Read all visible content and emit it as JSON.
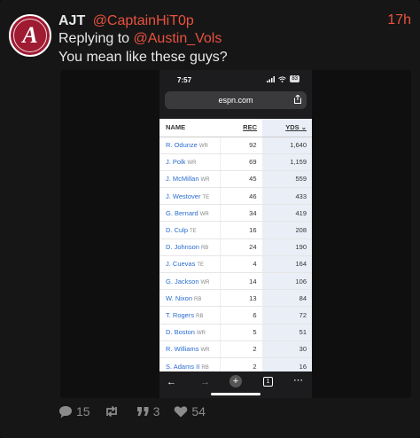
{
  "post": {
    "author_name": "AJT",
    "author_handle": "@CaptainHiT0p",
    "timestamp": "17h",
    "replying_prefix": "Replying to",
    "replying_to": "@Austin_Vols",
    "text": "You mean like these guys?",
    "avatar_logo_text": "ALABAMA CRIMSON TIDE",
    "avatar_letter": "A"
  },
  "screenshot": {
    "status_time": "7:57",
    "battery": "83",
    "url": "espn.com",
    "headers": {
      "name": "NAME",
      "rec": "REC",
      "yds": "YDS"
    },
    "rows": [
      {
        "name": "R. Odunze",
        "pos": "WR",
        "rec": "92",
        "yds": "1,640"
      },
      {
        "name": "J. Polk",
        "pos": "WR",
        "rec": "69",
        "yds": "1,159"
      },
      {
        "name": "J. McMillan",
        "pos": "WR",
        "rec": "45",
        "yds": "559"
      },
      {
        "name": "J. Westover",
        "pos": "TE",
        "rec": "46",
        "yds": "433"
      },
      {
        "name": "G. Bernard",
        "pos": "WR",
        "rec": "34",
        "yds": "419"
      },
      {
        "name": "D. Culp",
        "pos": "TE",
        "rec": "16",
        "yds": "208"
      },
      {
        "name": "D. Johnson",
        "pos": "RB",
        "rec": "24",
        "yds": "190"
      },
      {
        "name": "J. Cuevas",
        "pos": "TE",
        "rec": "4",
        "yds": "164"
      },
      {
        "name": "G. Jackson",
        "pos": "WR",
        "rec": "14",
        "yds": "106"
      },
      {
        "name": "W. Nixon",
        "pos": "RB",
        "rec": "13",
        "yds": "84"
      },
      {
        "name": "T. Rogers",
        "pos": "RB",
        "rec": "6",
        "yds": "72"
      },
      {
        "name": "D. Boston",
        "pos": "WR",
        "rec": "5",
        "yds": "51"
      },
      {
        "name": "R. Williams",
        "pos": "WR",
        "rec": "2",
        "yds": "30"
      },
      {
        "name": "S. Adams II",
        "pos": "RB",
        "rec": "2",
        "yds": "16"
      }
    ],
    "tab_count": "1"
  },
  "actions": {
    "replies": "15",
    "reposts": "",
    "quotes": "3",
    "likes": "54"
  },
  "colors": {
    "accent": "#e8523f",
    "background": "#161616",
    "link_blue": "#2b6dd0",
    "avatar_crimson": "#9e1b32"
  },
  "icons": [
    "reply-icon",
    "repost-icon",
    "quote-icon",
    "like-icon",
    "share-icon",
    "back-icon",
    "forward-icon",
    "new-tab-icon",
    "tabs-icon",
    "more-icon"
  ]
}
